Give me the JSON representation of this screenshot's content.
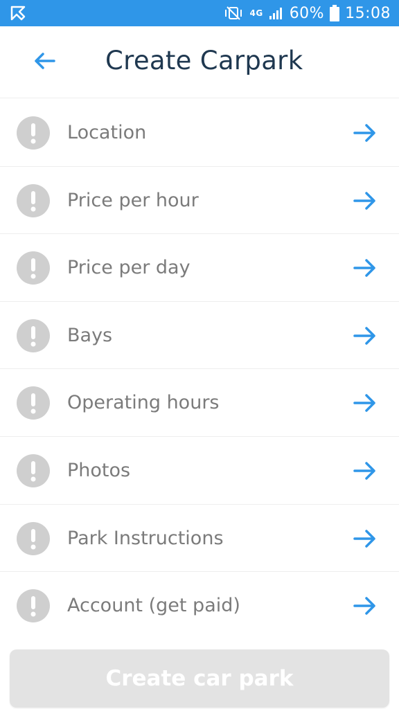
{
  "status_bar": {
    "network": "4G",
    "battery": "60%",
    "time": "15:08",
    "color": "#2f96e8"
  },
  "header": {
    "title": "Create Carpark",
    "back_icon": "arrow-left-icon"
  },
  "items": [
    {
      "label": "Location",
      "status_icon": "alert-icon",
      "nav_icon": "arrow-right-icon"
    },
    {
      "label": "Price per hour",
      "status_icon": "alert-icon",
      "nav_icon": "arrow-right-icon"
    },
    {
      "label": "Price per day",
      "status_icon": "alert-icon",
      "nav_icon": "arrow-right-icon"
    },
    {
      "label": "Bays",
      "status_icon": "alert-icon",
      "nav_icon": "arrow-right-icon"
    },
    {
      "label": "Operating hours",
      "status_icon": "alert-icon",
      "nav_icon": "arrow-right-icon"
    },
    {
      "label": "Photos",
      "status_icon": "alert-icon",
      "nav_icon": "arrow-right-icon"
    },
    {
      "label": "Park Instructions",
      "status_icon": "alert-icon",
      "nav_icon": "arrow-right-icon"
    },
    {
      "label": "Account (get paid)",
      "status_icon": "alert-icon",
      "nav_icon": "arrow-right-icon"
    }
  ],
  "create_button": {
    "label": "Create car park",
    "enabled": false
  },
  "colors": {
    "accent": "#2f96e8",
    "title": "#1f3850",
    "label": "#7b7b7b",
    "alert": "#cfcfcf",
    "button_disabled": "#e3e3e3"
  }
}
